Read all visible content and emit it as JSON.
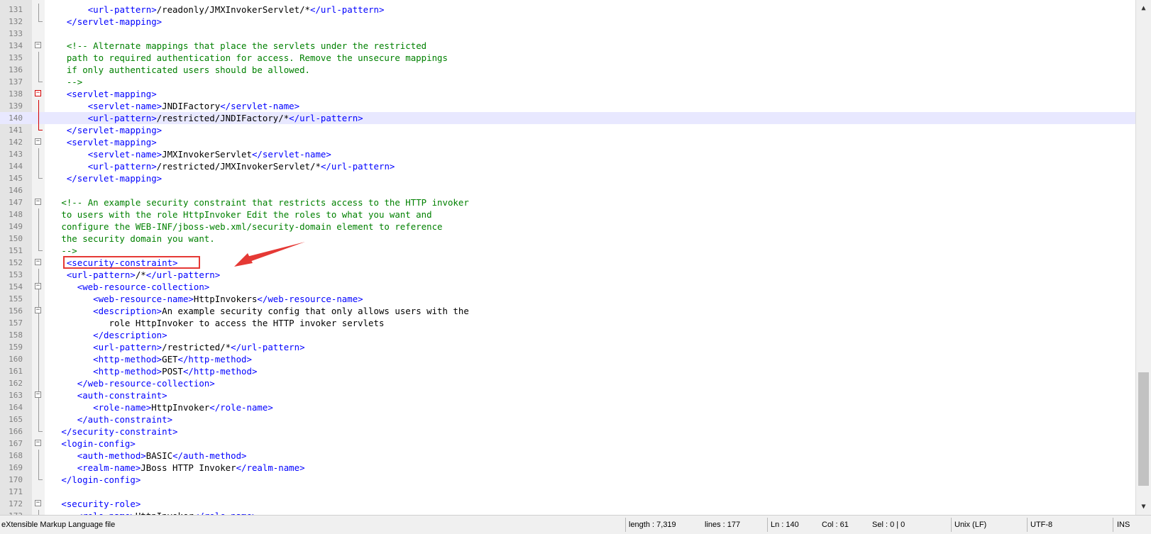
{
  "editor": {
    "current_line": 140,
    "lines": [
      {
        "n": "131",
        "fold": "",
        "guide": "gray",
        "segs": [
          [
            "txt",
            "        "
          ],
          [
            "tag",
            "<url-pattern>"
          ],
          [
            "txt",
            "/readonly/JMXInvokerServlet/*"
          ],
          [
            "tag",
            "</url-pattern>"
          ]
        ]
      },
      {
        "n": "132",
        "fold": "",
        "guide": "gray-end",
        "segs": [
          [
            "txt",
            "    "
          ],
          [
            "tag",
            "</servlet-mapping>"
          ]
        ]
      },
      {
        "n": "133",
        "fold": "",
        "guide": "",
        "segs": []
      },
      {
        "n": "134",
        "fold": "minus",
        "guide": "",
        "segs": [
          [
            "txt",
            "    "
          ],
          [
            "cmt",
            "<!-- Alternate mappings that place the servlets under the restricted"
          ]
        ]
      },
      {
        "n": "135",
        "fold": "",
        "guide": "gray",
        "segs": [
          [
            "cmt",
            "    path to required authentication for access. Remove the unsecure mappings"
          ]
        ]
      },
      {
        "n": "136",
        "fold": "",
        "guide": "gray",
        "segs": [
          [
            "cmt",
            "    if only authenticated users should be allowed."
          ]
        ]
      },
      {
        "n": "137",
        "fold": "",
        "guide": "gray-end",
        "segs": [
          [
            "cmt",
            "    -->"
          ]
        ]
      },
      {
        "n": "138",
        "fold": "minus-red",
        "guide": "",
        "segs": [
          [
            "txt",
            "    "
          ],
          [
            "tag",
            "<servlet-mapping>"
          ]
        ]
      },
      {
        "n": "139",
        "fold": "",
        "guide": "red",
        "segs": [
          [
            "txt",
            "        "
          ],
          [
            "tag",
            "<servlet-name>"
          ],
          [
            "txt",
            "JNDIFactory"
          ],
          [
            "tag",
            "</servlet-name>"
          ]
        ]
      },
      {
        "n": "140",
        "fold": "",
        "guide": "red",
        "segs": [
          [
            "txt",
            "        "
          ],
          [
            "tag",
            "<url-pattern>"
          ],
          [
            "txt",
            "/restricted/JNDIFactory/*"
          ],
          [
            "tag",
            "</url-pattern>"
          ]
        ]
      },
      {
        "n": "141",
        "fold": "",
        "guide": "red-end",
        "segs": [
          [
            "txt",
            "    "
          ],
          [
            "tag",
            "</servlet-mapping>"
          ]
        ]
      },
      {
        "n": "142",
        "fold": "minus",
        "guide": "",
        "segs": [
          [
            "txt",
            "    "
          ],
          [
            "tag",
            "<servlet-mapping>"
          ]
        ]
      },
      {
        "n": "143",
        "fold": "",
        "guide": "gray",
        "segs": [
          [
            "txt",
            "        "
          ],
          [
            "tag",
            "<servlet-name>"
          ],
          [
            "txt",
            "JMXInvokerServlet"
          ],
          [
            "tag",
            "</servlet-name>"
          ]
        ]
      },
      {
        "n": "144",
        "fold": "",
        "guide": "gray",
        "segs": [
          [
            "txt",
            "        "
          ],
          [
            "tag",
            "<url-pattern>"
          ],
          [
            "txt",
            "/restricted/JMXInvokerServlet/*"
          ],
          [
            "tag",
            "</url-pattern>"
          ]
        ]
      },
      {
        "n": "145",
        "fold": "",
        "guide": "gray-end",
        "segs": [
          [
            "txt",
            "    "
          ],
          [
            "tag",
            "</servlet-mapping>"
          ]
        ]
      },
      {
        "n": "146",
        "fold": "",
        "guide": "",
        "segs": []
      },
      {
        "n": "147",
        "fold": "minus",
        "guide": "",
        "segs": [
          [
            "txt",
            "   "
          ],
          [
            "cmt",
            "<!-- An example security constraint that restricts access to the HTTP invoker"
          ]
        ]
      },
      {
        "n": "148",
        "fold": "",
        "guide": "gray",
        "segs": [
          [
            "cmt",
            "   to users with the role HttpInvoker Edit the roles to what you want and"
          ]
        ]
      },
      {
        "n": "149",
        "fold": "",
        "guide": "gray",
        "segs": [
          [
            "cmt",
            "   configure the WEB-INF/jboss-web.xml/security-domain element to reference"
          ]
        ]
      },
      {
        "n": "150",
        "fold": "",
        "guide": "gray",
        "segs": [
          [
            "cmt",
            "   the security domain you want."
          ]
        ]
      },
      {
        "n": "151",
        "fold": "",
        "guide": "gray-end",
        "segs": [
          [
            "cmt",
            "   -->"
          ]
        ]
      },
      {
        "n": "152",
        "fold": "minus",
        "guide": "",
        "segs": [
          [
            "txt",
            "    "
          ],
          [
            "tag",
            "<security-constraint>"
          ]
        ]
      },
      {
        "n": "153",
        "fold": "",
        "guide": "gray",
        "segs": [
          [
            "txt",
            "    "
          ],
          [
            "tag",
            "<url-pattern>"
          ],
          [
            "txt",
            "/*"
          ],
          [
            "tag",
            "</url-pattern>"
          ]
        ]
      },
      {
        "n": "154",
        "fold": "minus",
        "guide": "gray",
        "segs": [
          [
            "txt",
            "      "
          ],
          [
            "tag",
            "<web-resource-collection>"
          ]
        ]
      },
      {
        "n": "155",
        "fold": "",
        "guide": "gray",
        "segs": [
          [
            "txt",
            "         "
          ],
          [
            "tag",
            "<web-resource-name>"
          ],
          [
            "txt",
            "HttpInvokers"
          ],
          [
            "tag",
            "</web-resource-name>"
          ]
        ]
      },
      {
        "n": "156",
        "fold": "minus",
        "guide": "gray",
        "segs": [
          [
            "txt",
            "         "
          ],
          [
            "tag",
            "<description>"
          ],
          [
            "txt",
            "An example security config that only allows users with the"
          ]
        ]
      },
      {
        "n": "157",
        "fold": "",
        "guide": "gray",
        "segs": [
          [
            "txt",
            "            role HttpInvoker to access the HTTP invoker servlets"
          ]
        ]
      },
      {
        "n": "158",
        "fold": "",
        "guide": "gray",
        "segs": [
          [
            "txt",
            "         "
          ],
          [
            "tag",
            "</description>"
          ]
        ]
      },
      {
        "n": "159",
        "fold": "",
        "guide": "gray",
        "segs": [
          [
            "txt",
            "         "
          ],
          [
            "tag",
            "<url-pattern>"
          ],
          [
            "txt",
            "/restricted/*"
          ],
          [
            "tag",
            "</url-pattern>"
          ]
        ]
      },
      {
        "n": "160",
        "fold": "",
        "guide": "gray",
        "segs": [
          [
            "txt",
            "         "
          ],
          [
            "tag",
            "<http-method>"
          ],
          [
            "txt",
            "GET"
          ],
          [
            "tag",
            "</http-method>"
          ]
        ]
      },
      {
        "n": "161",
        "fold": "",
        "guide": "gray",
        "segs": [
          [
            "txt",
            "         "
          ],
          [
            "tag",
            "<http-method>"
          ],
          [
            "txt",
            "POST"
          ],
          [
            "tag",
            "</http-method>"
          ]
        ]
      },
      {
        "n": "162",
        "fold": "",
        "guide": "gray",
        "segs": [
          [
            "txt",
            "      "
          ],
          [
            "tag",
            "</web-resource-collection>"
          ]
        ]
      },
      {
        "n": "163",
        "fold": "minus",
        "guide": "gray",
        "segs": [
          [
            "txt",
            "      "
          ],
          [
            "tag",
            "<auth-constraint>"
          ]
        ]
      },
      {
        "n": "164",
        "fold": "",
        "guide": "gray",
        "segs": [
          [
            "txt",
            "         "
          ],
          [
            "tag",
            "<role-name>"
          ],
          [
            "txt",
            "HttpInvoker"
          ],
          [
            "tag",
            "</role-name>"
          ]
        ]
      },
      {
        "n": "165",
        "fold": "",
        "guide": "gray",
        "segs": [
          [
            "txt",
            "      "
          ],
          [
            "tag",
            "</auth-constraint>"
          ]
        ]
      },
      {
        "n": "166",
        "fold": "",
        "guide": "gray-end",
        "segs": [
          [
            "txt",
            "   "
          ],
          [
            "tag",
            "</security-constraint>"
          ]
        ]
      },
      {
        "n": "167",
        "fold": "minus",
        "guide": "",
        "segs": [
          [
            "txt",
            "   "
          ],
          [
            "tag",
            "<login-config>"
          ]
        ]
      },
      {
        "n": "168",
        "fold": "",
        "guide": "gray",
        "segs": [
          [
            "txt",
            "      "
          ],
          [
            "tag",
            "<auth-method>"
          ],
          [
            "txt",
            "BASIC"
          ],
          [
            "tag",
            "</auth-method>"
          ]
        ]
      },
      {
        "n": "169",
        "fold": "",
        "guide": "gray",
        "segs": [
          [
            "txt",
            "      "
          ],
          [
            "tag",
            "<realm-name>"
          ],
          [
            "txt",
            "JBoss HTTP Invoker"
          ],
          [
            "tag",
            "</realm-name>"
          ]
        ]
      },
      {
        "n": "170",
        "fold": "",
        "guide": "gray-end",
        "segs": [
          [
            "txt",
            "   "
          ],
          [
            "tag",
            "</login-config>"
          ]
        ]
      },
      {
        "n": "171",
        "fold": "",
        "guide": "",
        "segs": []
      },
      {
        "n": "172",
        "fold": "minus",
        "guide": "",
        "segs": [
          [
            "txt",
            "   "
          ],
          [
            "tag",
            "<security-role>"
          ]
        ]
      },
      {
        "n": "173",
        "fold": "",
        "guide": "gray",
        "segs": [
          [
            "txt",
            "      "
          ],
          [
            "tag",
            "<role-name>"
          ],
          [
            "txt",
            "HttpInvoker"
          ],
          [
            "tag",
            "</role-name>"
          ]
        ]
      }
    ]
  },
  "statusbar": {
    "file_type": "eXtensible Markup Language file",
    "length": "length : 7,319",
    "lines": "lines : 177",
    "position_ln": "Ln : 140",
    "position_col": "Col : 61",
    "selection": "Sel : 0 | 0",
    "eol": "Unix (LF)",
    "encoding": "UTF-8",
    "mode": "INS"
  },
  "icons": {
    "fold_box": "fold-minus-icon",
    "scroll_up": "scroll-up-arrow-icon",
    "scroll_down": "scroll-down-arrow-icon",
    "annotation": "red-arrow-annotation"
  },
  "colors": {
    "tag": "#0000ff",
    "comment": "#008000",
    "text": "#000000",
    "current_line": "#e8e8ff",
    "annotation": "#e53935"
  }
}
